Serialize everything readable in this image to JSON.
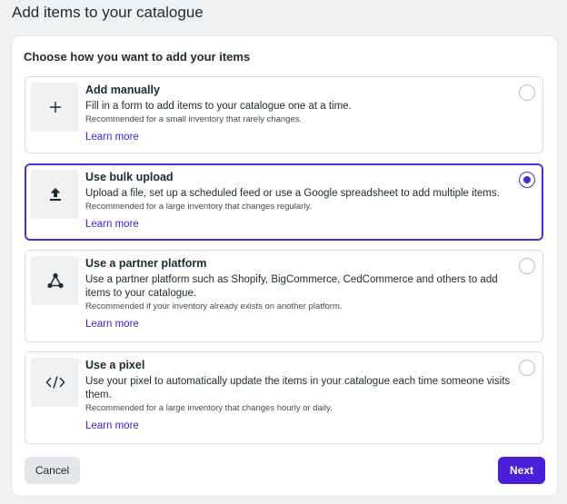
{
  "page": {
    "title": "Add items to your catalogue"
  },
  "dialog": {
    "heading": "Choose how you want to add your items",
    "options": [
      {
        "icon": "plus-icon",
        "title": "Add manually",
        "description": "Fill in a form to add items to your catalogue one at a time.",
        "recommendation": "Recommended for a small inventory that rarely changes.",
        "link": "Learn more",
        "selected": false
      },
      {
        "icon": "upload-icon",
        "title": "Use bulk upload",
        "description": "Upload a file, set up a scheduled feed or use a Google spreadsheet to add multiple items.",
        "recommendation": "Recommended for a large inventory that changes regularly.",
        "link": "Learn more",
        "selected": true
      },
      {
        "icon": "partner-platform-icon",
        "title": "Use a partner platform",
        "description": "Use a partner platform such as Shopify, BigCommerce, CedCommerce and others to add items to your catalogue.",
        "recommendation": "Recommended if your inventory already exists on another platform.",
        "link": "Learn more",
        "selected": false
      },
      {
        "icon": "code-icon",
        "title": "Use a pixel",
        "description": "Use your pixel to automatically update the items in your catalogue each time someone visits them.",
        "recommendation": "Recommended for a large inventory that changes hourly or daily.",
        "link": "Learn more",
        "selected": false
      }
    ],
    "buttons": {
      "cancel": "Cancel",
      "next": "Next"
    }
  },
  "colors": {
    "accent": "#4a1fd8",
    "link": "#3a1fd0",
    "background": "#f0f1f3"
  }
}
